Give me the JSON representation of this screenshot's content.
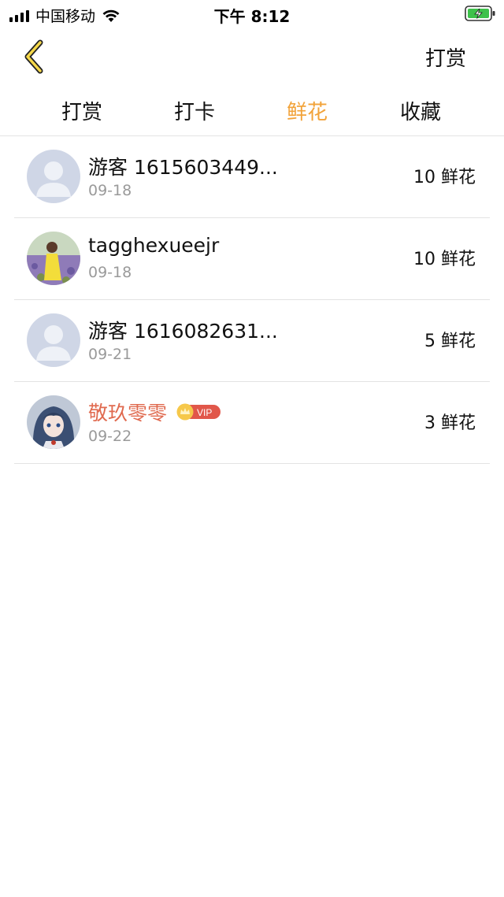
{
  "status_bar": {
    "carrier": "中国移动",
    "time": "下午 8:12"
  },
  "nav": {
    "action_label": "打赏"
  },
  "tabs": [
    {
      "label": "打赏",
      "active": false
    },
    {
      "label": "打卡",
      "active": false
    },
    {
      "label": "鲜花",
      "active": true
    },
    {
      "label": "收藏",
      "active": false
    }
  ],
  "records": [
    {
      "name": "游客 1615603449...",
      "date": "09-18",
      "amount": "10 鲜花",
      "avatar": "default-avatar",
      "vip": false
    },
    {
      "name": "tagghexueejr",
      "date": "09-18",
      "amount": "10 鲜花",
      "avatar": "photo-avatar",
      "vip": false
    },
    {
      "name": "游客 1616082631...",
      "date": "09-21",
      "amount": "5 鲜花",
      "avatar": "default-avatar",
      "vip": false
    },
    {
      "name": "敬玖零零",
      "date": "09-22",
      "amount": "3 鲜花",
      "avatar": "anime-avatar",
      "vip": true,
      "vip_label": "VIP"
    }
  ],
  "colors": {
    "accent": "#f2a33a",
    "vip_name": "#e06a4f",
    "date_gray": "#9a9a9a"
  }
}
